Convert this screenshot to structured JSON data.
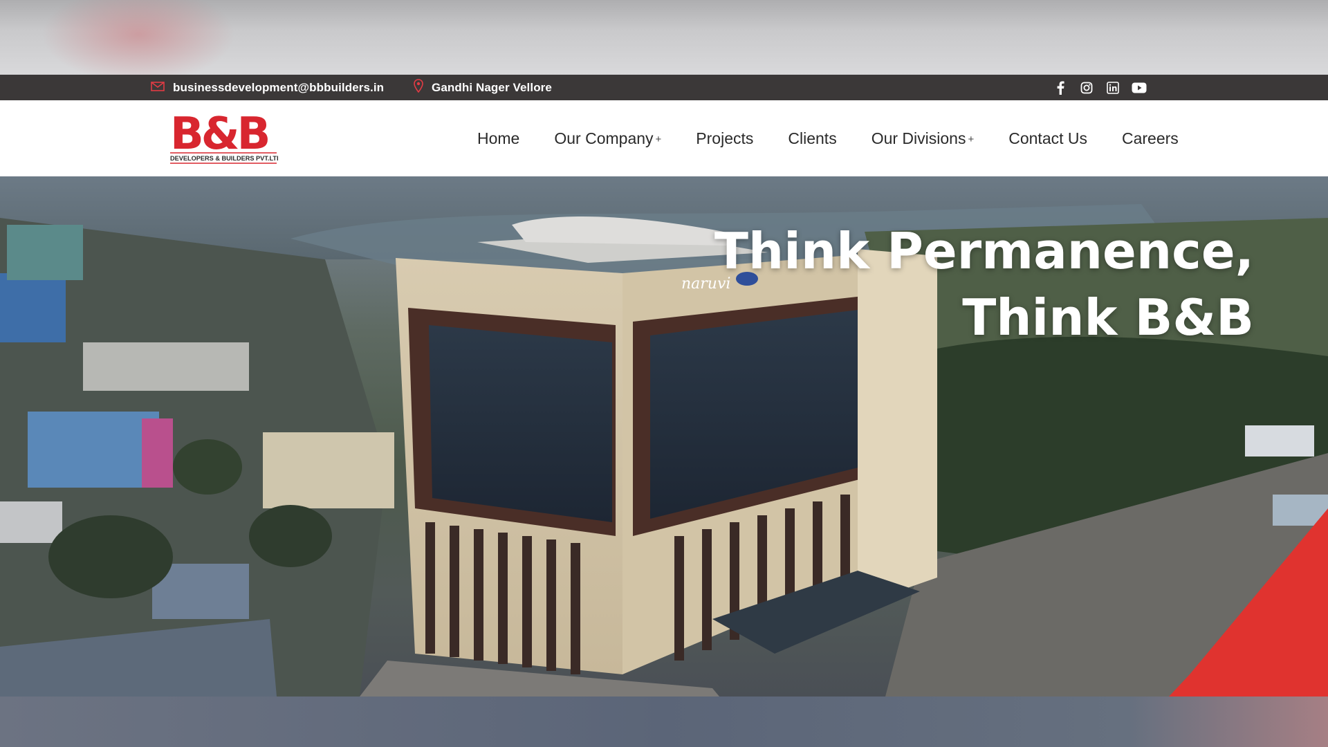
{
  "topbar": {
    "email": "businessdevelopment@bbbuilders.in",
    "location": "Gandhi Nager Vellore",
    "socials": [
      "facebook-icon",
      "instagram-icon",
      "linkedin-icon",
      "youtube-icon"
    ]
  },
  "logo": {
    "main": "B&B",
    "tagline": "DEVELOPERS & BUILDERS PVT.LTD."
  },
  "nav": {
    "items": [
      {
        "label": "Home",
        "has_submenu": false
      },
      {
        "label": "Our Company",
        "has_submenu": true
      },
      {
        "label": "Projects",
        "has_submenu": false
      },
      {
        "label": "Clients",
        "has_submenu": false
      },
      {
        "label": "Our Divisions",
        "has_submenu": true
      },
      {
        "label": "Contact Us",
        "has_submenu": false
      },
      {
        "label": "Careers",
        "has_submenu": false
      }
    ],
    "submenu_marker": "+"
  },
  "hero": {
    "line1": "Think Permanence,",
    "line2": "Think B&B",
    "building_sign": "naruvi"
  },
  "colors": {
    "brand_red": "#d8262f",
    "topbar_bg": "#3b3838",
    "nav_text": "#2a2a2a"
  }
}
